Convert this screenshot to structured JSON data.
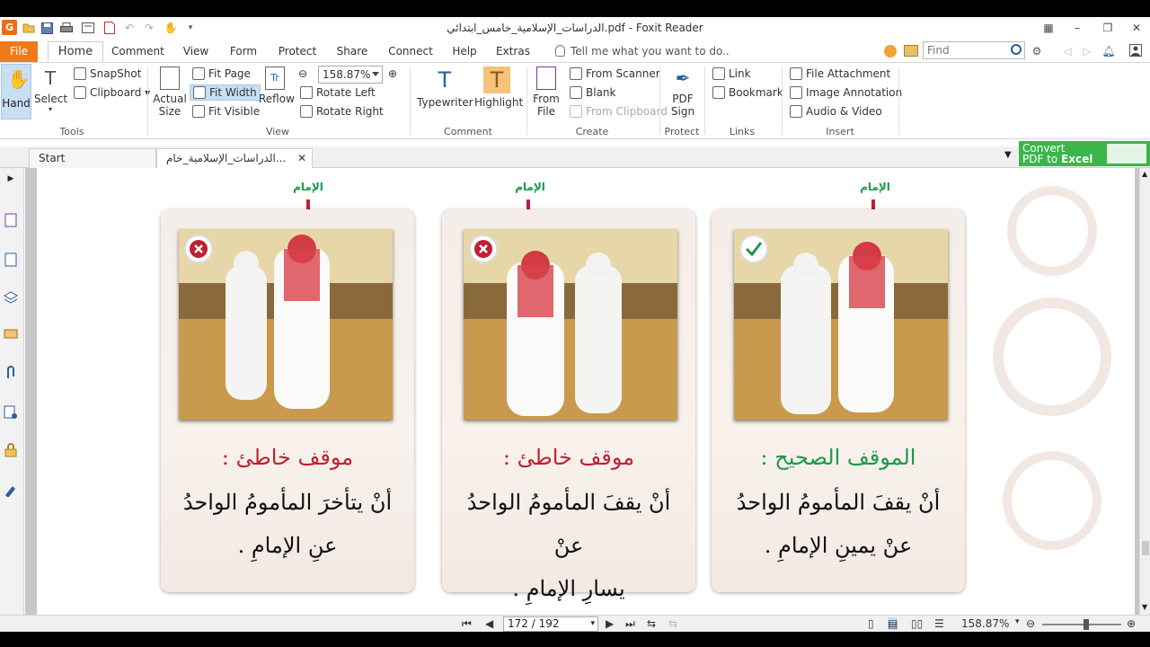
{
  "window": {
    "title": "الدراسات_الإسلامية_خامس_ابتدائي.pdf - Foxit Reader",
    "app_logo": "G"
  },
  "menu": {
    "file": "File",
    "tabs": [
      "Home",
      "Comment",
      "View",
      "Form",
      "Protect",
      "Share",
      "Connect",
      "Help",
      "Extras"
    ],
    "active_tab": "Home",
    "tell_me": "Tell me what you want to do..",
    "find_placeholder": "Find"
  },
  "ribbon": {
    "tools": {
      "hand": "Hand",
      "select": "Select",
      "snapshot": "SnapShot",
      "clipboard": "Clipboard",
      "group": "Tools"
    },
    "view": {
      "actual_size_1": "Actual",
      "actual_size_2": "Size",
      "fit_page": "Fit Page",
      "fit_width": "Fit Width",
      "fit_visible": "Fit Visible",
      "reflow": "Reflow",
      "zoom": "158.87%",
      "rotate_left": "Rotate Left",
      "rotate_right": "Rotate Right",
      "group": "View"
    },
    "comment": {
      "typewriter": "Typewriter",
      "highlight": "Highlight",
      "group": "Comment"
    },
    "create": {
      "from_file_1": "From",
      "from_file_2": "File",
      "from_scanner": "From Scanner",
      "blank": "Blank",
      "from_clipboard": "From Clipboard",
      "group": "Create"
    },
    "protect": {
      "pdf_sign_1": "PDF",
      "pdf_sign_2": "Sign",
      "group": "Protect"
    },
    "links": {
      "link": "Link",
      "bookmark": "Bookmark",
      "group": "Links"
    },
    "insert": {
      "file_attachment": "File Attachment",
      "image_annotation": "Image Annotation",
      "audio_video": "Audio & Video",
      "group": "Insert"
    }
  },
  "doc_tabs": {
    "start": "Start",
    "current": "الدراسات_الإسلامية_خام..."
  },
  "convert_banner": {
    "line1": "Convert",
    "line2_a": "PDF to ",
    "line2_b": "Excel"
  },
  "cards": [
    {
      "imam": "الإمام",
      "status": "wrong",
      "title": "موقف خاطئ :",
      "line1": "أنْ يتأخرَ المأمومُ الواحدُ",
      "line2": "عنِ الإمامِ ."
    },
    {
      "imam": "الإمام",
      "status": "wrong",
      "title": "موقف خاطئ :",
      "line1": "أنْ يقفَ المأمومُ الواحدُ عنْ",
      "line2": "يسارِ الإمامِ ."
    },
    {
      "imam": "الإمام",
      "status": "correct",
      "title": "الموقف الصحيح :",
      "line1": "أنْ يقفَ المأمومُ الواحدُ",
      "line2": "عنْ يمينِ الإمامِ ."
    }
  ],
  "status_bar": {
    "page_display": "172 / 192",
    "zoom": "158.87%"
  },
  "colors": {
    "accent_orange": "#f07a1a",
    "wrong_red": "#c02033",
    "correct_green": "#1a9a4a",
    "convert_green": "#3cb54a"
  }
}
